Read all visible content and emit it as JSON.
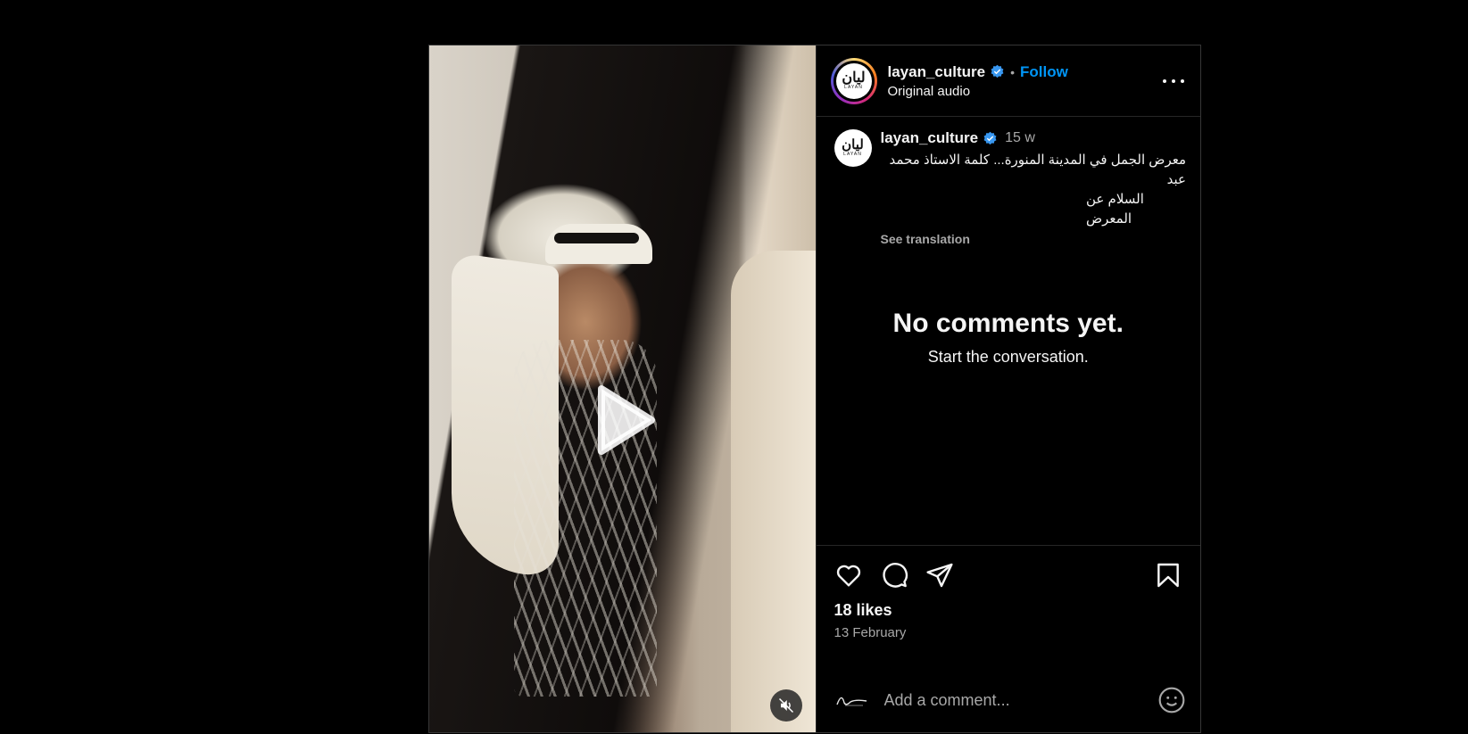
{
  "post": {
    "username": "layan_culture",
    "follow_label": "Follow",
    "separator": "•",
    "audio_label": "Original audio",
    "logo_mark": "ليان",
    "logo_word": "LAYAN"
  },
  "caption": {
    "username": "layan_culture",
    "time_ago": "15 w",
    "text_line1": "معرض الجمل في المدينة المنورة... كلمة الاستاذ محمد عبد",
    "text_line2": "السلام عن المعرض",
    "see_translation": "See translation"
  },
  "comments": {
    "empty_title": "No comments yet.",
    "empty_subtitle": "Start the conversation."
  },
  "actions": {
    "likes": "18 likes",
    "date": "13 February"
  },
  "comment_bar": {
    "placeholder": "Add a comment..."
  },
  "colors": {
    "accent": "#0095f6",
    "verified": "#3897f0",
    "muted": "#a8a8a8"
  },
  "icons": [
    "play-icon",
    "mute-icon",
    "verified-icon",
    "more-icon",
    "heart-icon",
    "comment-icon",
    "share-icon",
    "save-icon",
    "emoji-icon"
  ]
}
